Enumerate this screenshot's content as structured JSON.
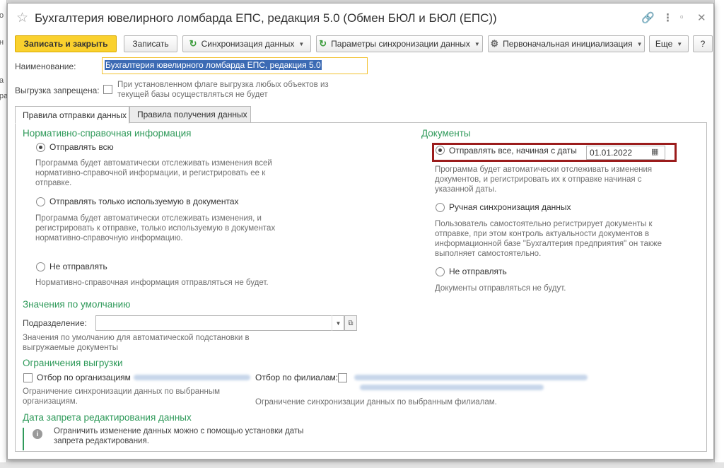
{
  "window": {
    "title": "Бухгалтерия ювелирного ломбарда ЕПС, редакция 5.0 (Обмен БЮЛ и БЮЛ (ЕПС))"
  },
  "toolbar": {
    "save_close": "Записать и закрыть",
    "save": "Записать",
    "sync_data": "Синхронизация данных",
    "sync_params": "Параметры синхронизации данных",
    "initial_init": "Первоначальная инициализация",
    "more": "Еще",
    "help": "?"
  },
  "form": {
    "name_label": "Наименование:",
    "name_value": "Бухгалтерия ювелирного ломбарда ЕПС, редакция 5.0",
    "export_forbidden_label": "Выгрузка запрещена:",
    "export_forbidden_hint": "При установленном флаге выгрузка любых объектов из текущей базы осуществляться не будет"
  },
  "tabs": [
    {
      "label": "Правила отправки данных",
      "active": true
    },
    {
      "label": "Правила получения данных",
      "active": false
    }
  ],
  "nsi": {
    "title": "Нормативно-справочная информация",
    "opt_all": "Отправлять всю",
    "opt_all_hint": "Программа будет автоматически отслеживать изменения всей нормативно-справочной информации, и регистрировать ее к отправке.",
    "opt_used": "Отправлять только используемую в документах",
    "opt_used_hint": "Программа будет автоматически отслеживать изменения, и регистрировать к отправке, только используемую в документах нормативно-справочную информацию.",
    "opt_none": "Не отправлять",
    "opt_none_hint": "Нормативно-справочная информация отправляться не будет."
  },
  "docs": {
    "title": "Документы",
    "opt_from_date": "Отправлять все, начиная с даты",
    "date_value": "01.01.2022",
    "opt_from_date_hint": "Программа будет автоматически отслеживать изменения документов, и регистрировать их к отправке начиная с указанной даты.",
    "opt_manual": "Ручная синхронизация данных",
    "opt_manual_hint": "Пользователь самостоятельно регистрирует документы к отправке, при этом контроль актуальности документов в информационной базе \"Бухгалтерия предприятия\" он также выполняет самостоятельно.",
    "opt_none": "Не отправлять",
    "opt_none_hint": "Документы отправляться не будут."
  },
  "defaults": {
    "title": "Значения по умолчанию",
    "subdivision_label": "Подразделение:",
    "subdivision_value": "",
    "hint": "Значения по умолчанию для автоматической подстановки в выгружаемые документы"
  },
  "limits": {
    "title": "Ограничения выгрузки",
    "by_org_label": "Отбор по организациям",
    "by_org_hint": "Ограничение синхронизации данных по выбранным организациям.",
    "by_branch_label": "Отбор по филиалам:",
    "by_branch_hint": "Ограничение синхронизации данных по выбранным филиалам."
  },
  "edit_lock": {
    "title": "Дата запрета редактирования данных",
    "info": "Ограничить изменение данных можно с помощью установки даты запрета редактирования."
  },
  "background": {
    "left_fragments": [
      "о",
      "н",
      "а",
      "ра"
    ]
  },
  "colors": {
    "accent_green": "#2f9a5a",
    "primary_button": "#fad12e",
    "highlight_frame": "#9b1c1c",
    "selection": "#3c6bb4"
  }
}
